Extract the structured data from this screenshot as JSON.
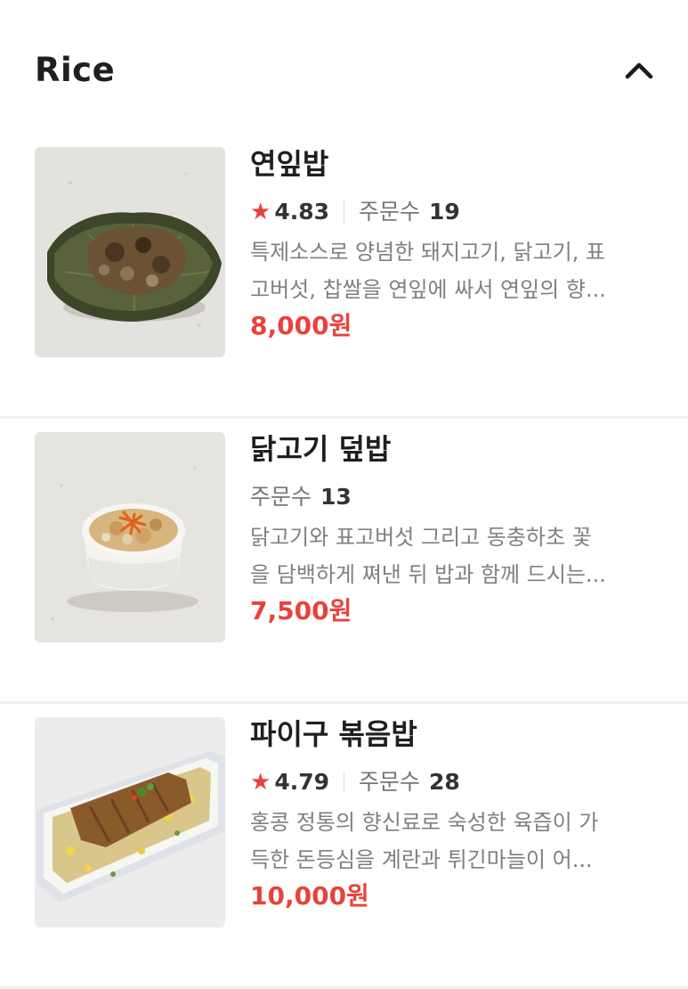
{
  "section": {
    "title": "Rice",
    "collapse_icon": "chevron-up-icon"
  },
  "items": [
    {
      "name": "연잎밥",
      "has_rating": true,
      "rating": "4.83",
      "orders_label": "주문수",
      "orders_count": "19",
      "desc_line1": "특제소스로 양념한 돼지고기, 닭고기, 표",
      "desc_line2": "고버섯, 찹쌀을 연잎에 싸서 연잎의 향...",
      "price": "8,000원",
      "image": "lotus-leaf-rice-photo"
    },
    {
      "name": "닭고기 덮밥",
      "has_rating": false,
      "orders_label": "주문수",
      "orders_count": "13",
      "desc_line1": "닭고기와 표고버섯 그리고 동충하초 꽃",
      "desc_line2": "을 담백하게 쪄낸 뒤 밥과 함께 드시는...",
      "price": "7,500원",
      "image": "chicken-rice-bowl-photo"
    },
    {
      "name": "파이구 볶음밥",
      "has_rating": true,
      "rating": "4.79",
      "orders_label": "주문수",
      "orders_count": "28",
      "desc_line1": "홍콩 정통의 향신료로 숙성한 육즙이 가",
      "desc_line2": "득한 돈등심을 계란과 튀긴마늘이 어...",
      "price": "10,000원",
      "image": "pork-cutlet-fried-rice-photo"
    }
  ],
  "colors": {
    "accent": "#e8423b",
    "divider": "#f1f1f1",
    "text": "#1f1f1f",
    "muted": "#808080"
  }
}
